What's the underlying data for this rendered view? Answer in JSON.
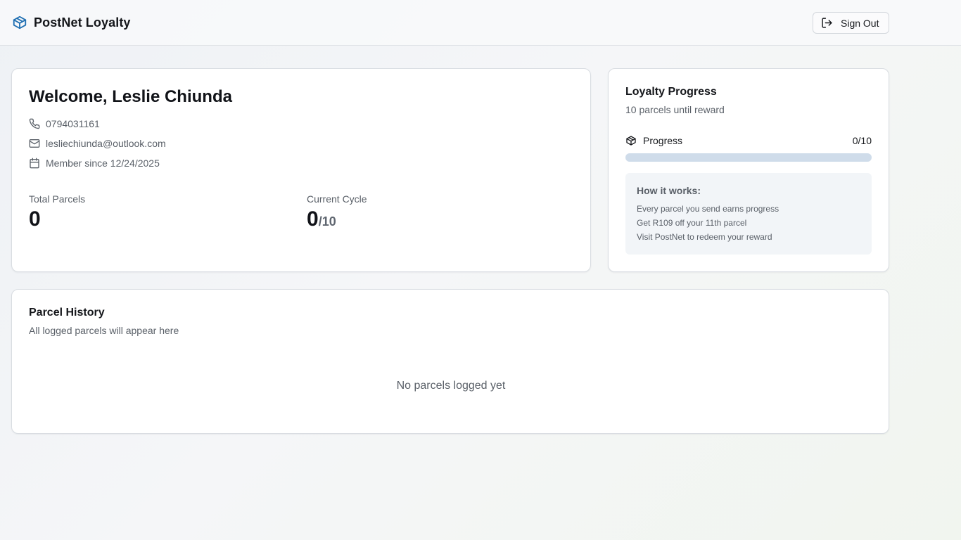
{
  "header": {
    "brand_title": "PostNet Loyalty",
    "brand_icon": "package-icon",
    "signout_label": "Sign Out",
    "signout_icon": "log-out-icon"
  },
  "welcome": {
    "title": "Welcome, Leslie Chiunda",
    "phone": "0794031161",
    "email": "lesliechiunda@outlook.com",
    "member_since": "Member since 12/24/2025",
    "total_parcels_label": "Total Parcels",
    "total_parcels_value": "0",
    "current_cycle_label": "Current Cycle",
    "current_cycle_value": "0",
    "current_cycle_suffix": "/10"
  },
  "loyalty": {
    "title": "Loyalty Progress",
    "subtitle": "10 parcels until reward",
    "progress_label": "Progress",
    "progress_count": "0/10",
    "progress_fraction": 0,
    "how_title": "How it works:",
    "how_items": [
      "Every parcel you send earns progress",
      "Get R109 off your 11th parcel",
      "Visit PostNet to redeem your reward"
    ]
  },
  "history": {
    "title": "Parcel History",
    "subtitle": "All logged parcels will appear here",
    "empty_message": "No parcels logged yet"
  },
  "colors": {
    "brand_blue": "#1f6fb2",
    "progress_track": "#cfdcea",
    "progress_fill": "#2f6fb0"
  }
}
